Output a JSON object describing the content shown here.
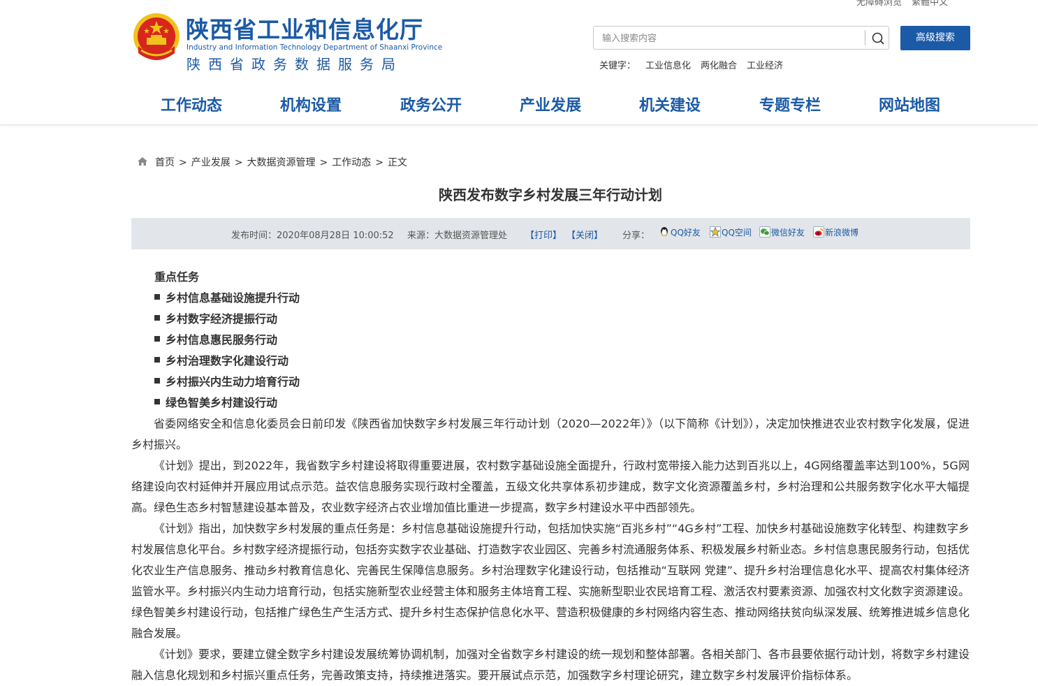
{
  "topbar": {
    "links": [
      "无障碍浏览",
      "繁體中文"
    ]
  },
  "header": {
    "title_cn": "陕西省工业和信息化厅",
    "title_en": "Industry and Information Technology Department of Shaanxi Province",
    "subtitle": "陕西省政务数据服务局",
    "search": {
      "placeholder": "输入搜索内容",
      "value": ""
    },
    "advanced_search": "高级搜索",
    "keywords_label": "关键字：",
    "keywords": [
      "工业信息化",
      "两化融合",
      "工业经济"
    ]
  },
  "nav": [
    "工作动态",
    "机构设置",
    "政务公开",
    "产业发展",
    "机关建设",
    "专题专栏",
    "网站地图"
  ],
  "breadcrumb": [
    "首页",
    "产业发展",
    "大数据资源管理",
    "工作动态",
    "正文"
  ],
  "article": {
    "title": "陕西发布数字乡村发展三年行动计划",
    "meta": {
      "publish_label": "发布时间：",
      "publish_time": "2020年08月28日 10:00:52",
      "source_label": "来源：",
      "source": "大数据资源管理处",
      "print": "【打印】",
      "close": "【关闭】",
      "share_label": "分享：",
      "share": [
        "QQ好友",
        "QQ空间",
        "微信好友",
        "新浪微博"
      ]
    },
    "task_heading": "重点任务",
    "tasks": [
      "乡村信息基础设施提升行动",
      "乡村数字经济提振行动",
      "乡村信息惠民服务行动",
      "乡村治理数字化建设行动",
      "乡村振兴内生动力培育行动",
      "绿色智美乡村建设行动"
    ],
    "paragraphs": [
      "省委网络安全和信息化委员会日前印发《陕西省加快数字乡村发展三年行动计划（2020—2022年）》（以下简称《计划》），决定加快推进农业农村数字化发展，促进乡村振兴。",
      "《计划》提出，到2022年，我省数字乡村建设将取得重要进展，农村数字基础设施全面提升，行政村宽带接入能力达到百兆以上，4G网络覆盖率达到100%，5G网络建设向农村延伸并开展应用试点示范。益农信息服务实现行政村全覆盖，五级文化共享体系初步建成，数字文化资源覆盖乡村，乡村治理和公共服务数字化水平大幅提高。绿色生态乡村智慧建设基本普及，农业数字经济占农业增加值比重进一步提高，数字乡村建设水平中西部领先。",
      "《计划》指出，加快数字乡村发展的重点任务是：乡村信息基础设施提升行动，包括加快实施“百兆乡村”“4G乡村”工程、加快乡村基础设施数字化转型、构建数字乡村发展信息化平台。乡村数字经济提振行动，包括夯实数字农业基础、打造数字农业园区、完善乡村流通服务体系、积极发展乡村新业态。乡村信息惠民服务行动，包括优化农业生产信息服务、推动乡村教育信息化、完善民生保障信息服务。乡村治理数字化建设行动，包括推动“互联网 党建”、提升乡村治理信息化水平、提高农村集体经济监管水平。乡村振兴内生动力培育行动，包括实施新型农业经营主体和服务主体培育工程、实施新型职业农民培育工程、激活农村要素资源、加强农村文化数字资源建设。绿色智美乡村建设行动，包括推广绿色生产生活方式、提升乡村生态保护信息化水平、营造积极健康的乡村网络内容生态、推动网络扶贫向纵深发展、统筹推进城乡信息化融合发展。",
      "《计划》要求，要建立健全数字乡村建设发展统筹协调机制，加强对全省数字乡村建设的统一规划和整体部署。各相关部门、各市县要依据行动计划，将数字乡村建设融入信息化规划和乡村振兴重点任务，完善政策支持，持续推进落实。要开展试点示范，加强数字乡村理论研究，建立数字乡村发展评价指标体系。"
    ]
  },
  "colors": {
    "brand_blue": "#1b5aa6",
    "meta_bg": "#e2e5e9",
    "emblem_red": "#d7261e",
    "emblem_gold": "#f2c21a"
  }
}
